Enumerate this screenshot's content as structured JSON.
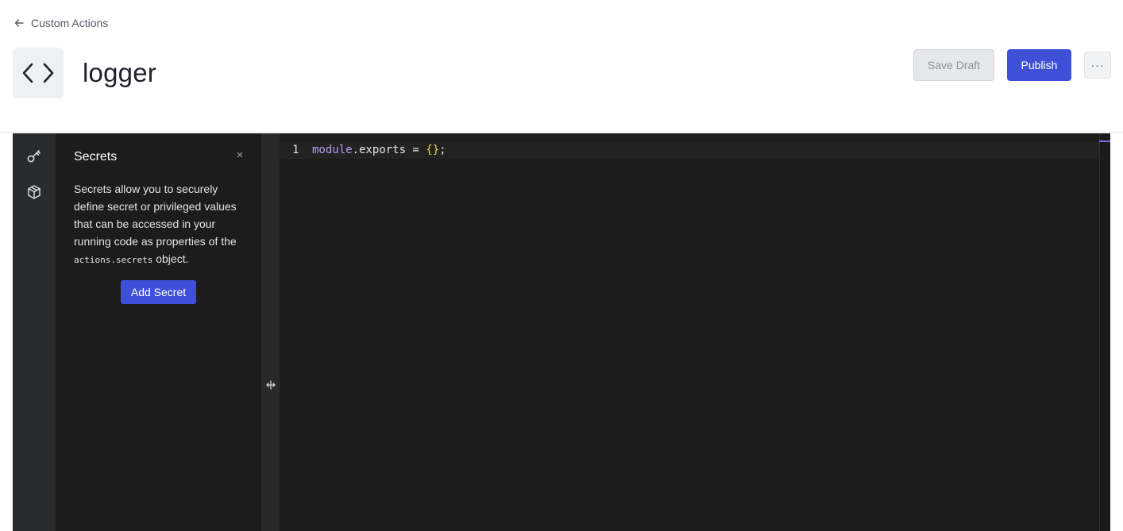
{
  "header": {
    "back_label": "Custom Actions",
    "title": "logger",
    "save_draft_label": "Save Draft",
    "publish_label": "Publish",
    "more_label": "···",
    "action_icon": "code-brackets-icon"
  },
  "sidebar_rail": {
    "items": [
      {
        "icon": "key-icon"
      },
      {
        "icon": "package-icon"
      }
    ]
  },
  "secrets_panel": {
    "title": "Secrets",
    "close_label": "×",
    "description_before": "Secrets allow you to securely define secret or privileged values that can be accessed in your running code as properties of the ",
    "description_code": "actions.secrets",
    "description_after": " object.",
    "add_button_label": "Add Secret"
  },
  "editor": {
    "line_number": "1",
    "code_tokens": {
      "module": "module",
      "rest": ".exports = ",
      "braces": "{}",
      "end": ";"
    }
  },
  "colors": {
    "accent": "#3e50d8",
    "editor_bg": "#1b1b1c",
    "rail_bg": "#2a2b2d"
  }
}
